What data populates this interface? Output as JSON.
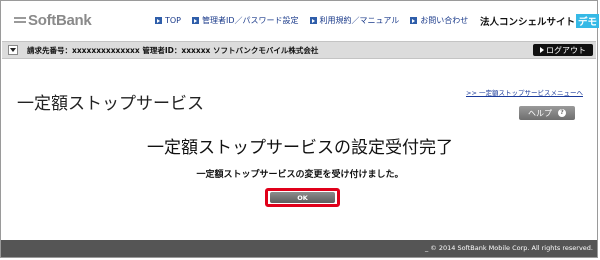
{
  "header": {
    "logo_text": "SoftBank",
    "nav": [
      {
        "label": "TOP"
      },
      {
        "label": "管理者ID／パスワード設定"
      },
      {
        "label": "利用規約／マニュアル"
      },
      {
        "label": "お問い合わせ"
      }
    ],
    "corp_title": "法人コンシェルサイト",
    "demo_badge": "デモ"
  },
  "infobar": {
    "text": "請求先番号：xxxxxxxxxxxxxx  管理者ID：xxxxxx  ソフトバンクモバイル株式会社",
    "logout_label": "ログアウト"
  },
  "main": {
    "page_title": "一定額ストップサービス",
    "menu_link": ">> 一定額ストップサービスメニューへ",
    "help_label": "ヘルプ",
    "help_glyph": "?",
    "complete_heading": "一定額ストップサービスの設定受付完了",
    "complete_message": "一定額ストップサービスの変更を受け付けました。",
    "ok_label": "OK"
  },
  "footer": {
    "copyright": "_ © 2014 SoftBank Mobile Corp. All rights reserved."
  },
  "colors": {
    "accent_blue": "#2f5eaa",
    "demo_badge": "#35b9e6",
    "highlight_red": "#e0001a",
    "footer_bg": "#555555"
  }
}
